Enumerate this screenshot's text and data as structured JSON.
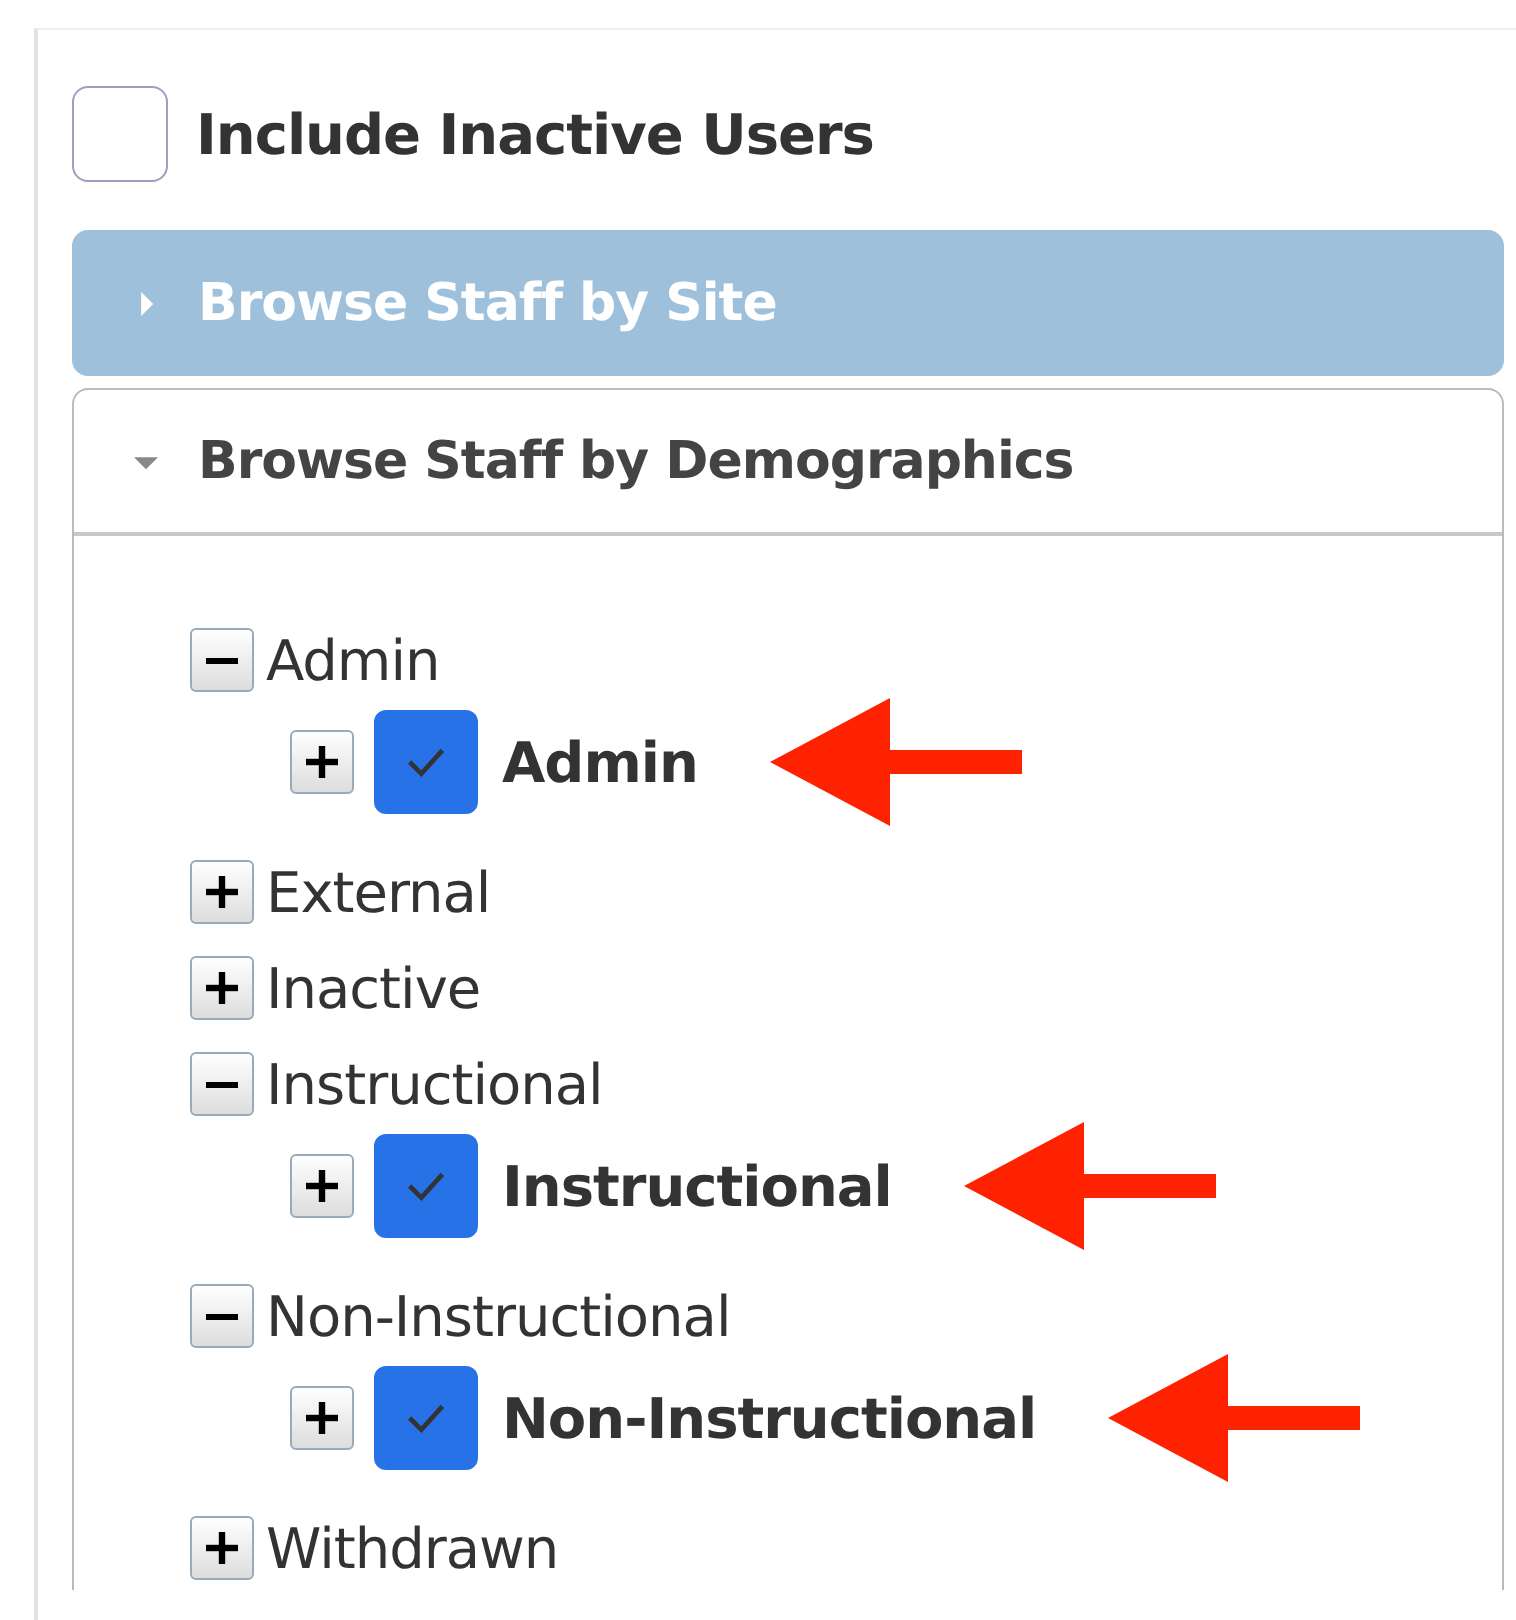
{
  "include_inactive": {
    "label": "Include Inactive Users",
    "checked": false
  },
  "panels": [
    {
      "title": "Browse Staff by Site",
      "expanded": false,
      "selected": true
    },
    {
      "title": "Browse Staff by Demographics",
      "expanded": true,
      "selected": false,
      "tree": [
        {
          "label": "Admin",
          "kind": "group",
          "expanded": true,
          "children": [
            {
              "label": "Admin",
              "kind": "checkbox",
              "expanded": false,
              "checked": true,
              "annotated": true
            }
          ]
        },
        {
          "label": "External",
          "kind": "group",
          "expanded": false
        },
        {
          "label": "Inactive",
          "kind": "group",
          "expanded": false
        },
        {
          "label": "Instructional",
          "kind": "group",
          "expanded": true,
          "children": [
            {
              "label": "Instructional",
              "kind": "checkbox",
              "expanded": false,
              "checked": true,
              "annotated": true
            }
          ]
        },
        {
          "label": "Non-Instructional",
          "kind": "group",
          "expanded": true,
          "children": [
            {
              "label": "Non-Instructional",
              "kind": "checkbox",
              "expanded": false,
              "checked": true,
              "annotated": true
            }
          ]
        },
        {
          "label": "Withdrawn",
          "kind": "group",
          "expanded": false
        }
      ]
    }
  ]
}
